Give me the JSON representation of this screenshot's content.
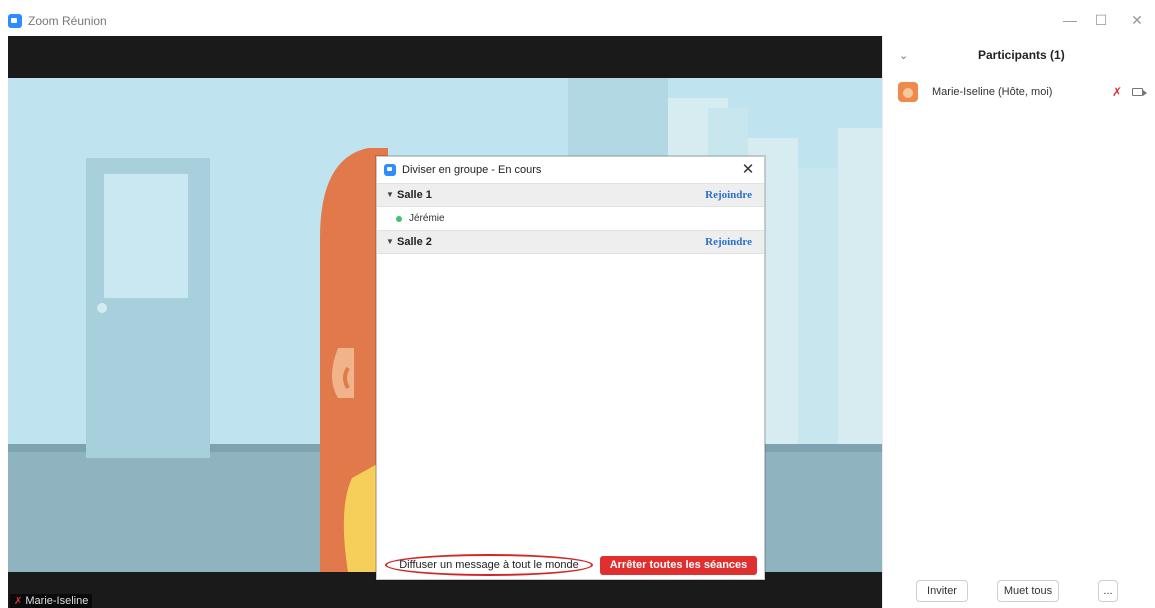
{
  "window": {
    "title": "Zoom Réunion",
    "minimize": "—",
    "maximize": "☐",
    "close": "✕"
  },
  "video": {
    "name_label": "Marie-Iseline"
  },
  "breakout_dialog": {
    "title": "Diviser en groupe - En cours",
    "close": "✕",
    "rooms": [
      {
        "name": "Salle 1",
        "join_label": "Rejoindre",
        "members": [
          "Jérémie"
        ]
      },
      {
        "name": "Salle 2",
        "join_label": "Rejoindre",
        "members": []
      }
    ],
    "broadcast_label": "Diffuser un message à tout le monde",
    "stop_label": "Arrêter toutes les séances"
  },
  "participants_panel": {
    "title": "Participants (1)",
    "participants": [
      {
        "name": "Marie-Iseline (Hôte, moi)",
        "mic_icon": "mic-muted-icon",
        "cam_icon": "camera-icon"
      }
    ],
    "invite_label": "Inviter",
    "mute_all_label": "Muet tous",
    "more_label": "..."
  },
  "colors": {
    "accent_blue": "#2d8cff",
    "danger_red": "#e02f2f",
    "join_blue": "#2d6fcb"
  }
}
